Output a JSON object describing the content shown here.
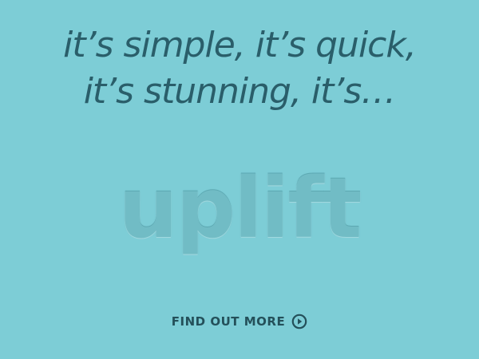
{
  "hero": {
    "tagline_lines": [
      "it’s simple, it’s quick,",
      "it’s stunning, it’s…"
    ],
    "wordmark": "uplift"
  },
  "cta": {
    "label": "FIND OUT MORE",
    "icon": "play-circle-icon"
  },
  "colors": {
    "background": "#7dcdd6",
    "tagline_text": "#2a5e6a",
    "cta_text": "#24505a",
    "wordmark": "#71bcc5"
  }
}
